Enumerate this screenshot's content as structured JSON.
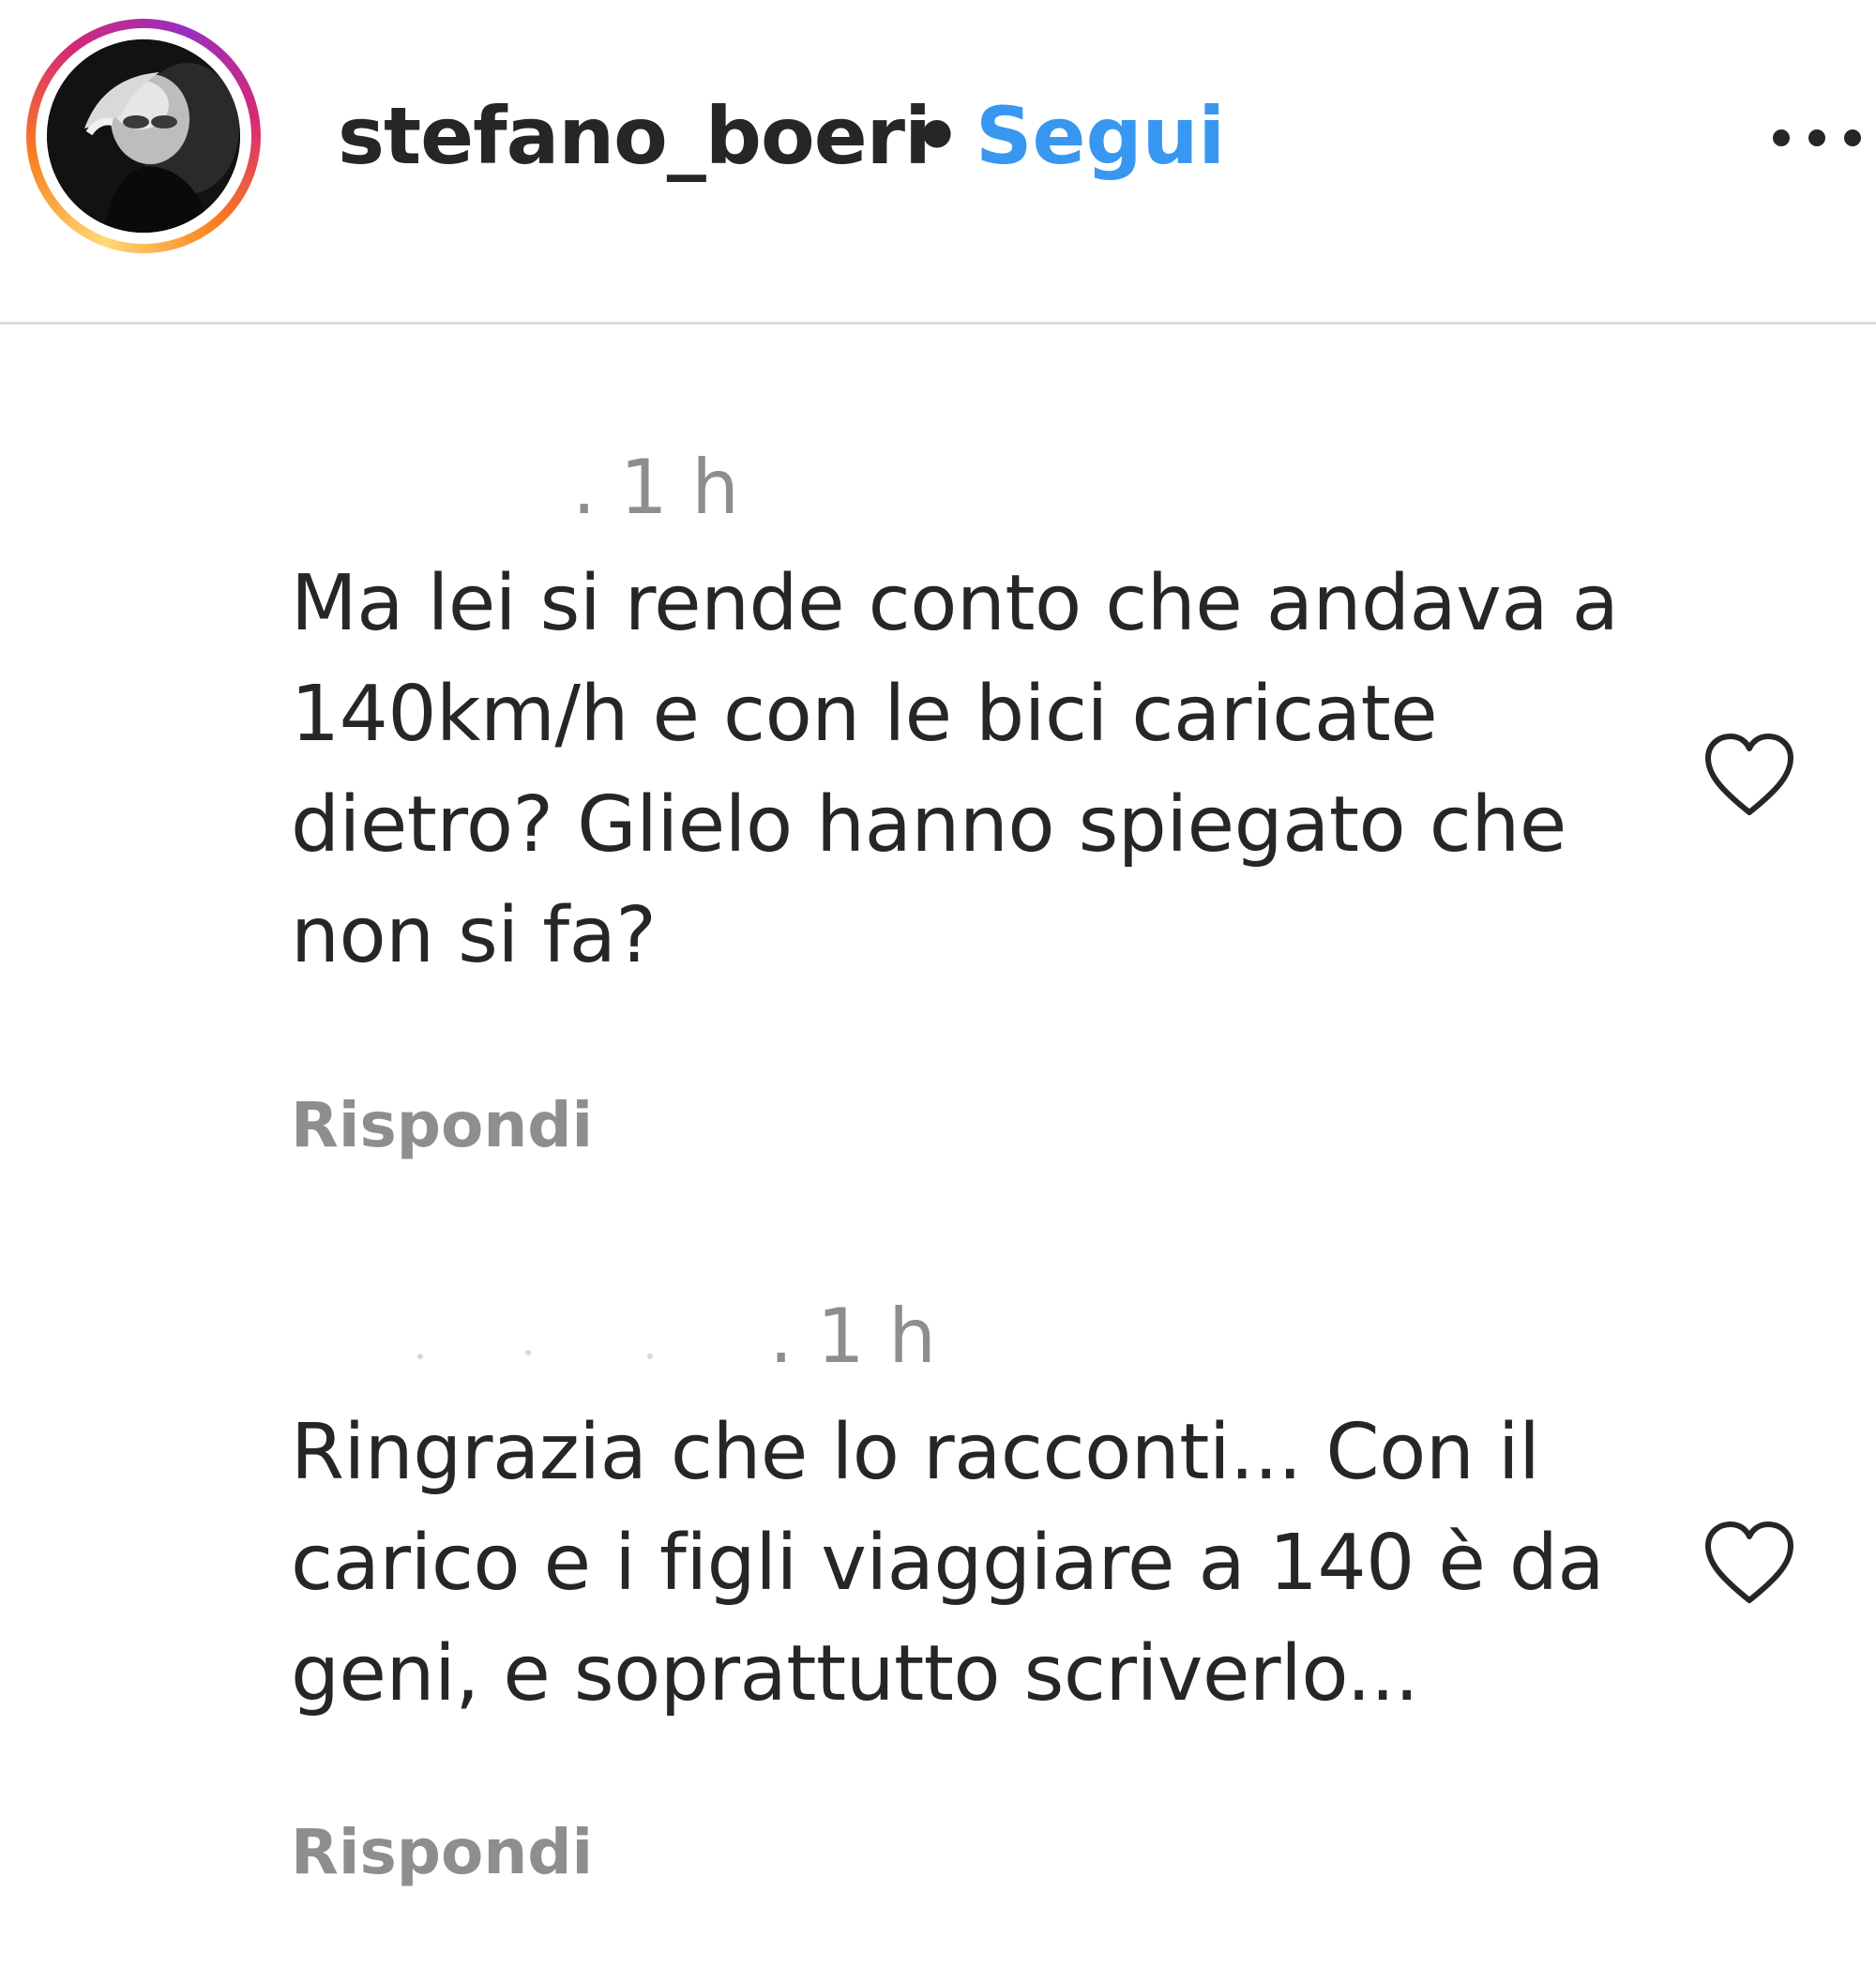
{
  "header": {
    "username": "stefano_boeri",
    "separator": "•",
    "follow_label": "Segui",
    "avatar_icon": "profile-photo",
    "more_icon": "more-options-icon"
  },
  "comments": [
    {
      "time": ". 1 h",
      "text": "Ma lei si rende conto che andava a 140km/h e con le bici caricate dietro? Glielo hanno spiegato che non si fa?",
      "reply_label": "Rispondi",
      "like_icon": "heart-icon"
    },
    {
      "time": ". 1 h",
      "text": "Ringrazia che lo racconti... Con il carico e i figli viaggiare a 140 è da geni, e soprattutto scriverlo...",
      "reply_label": "Rispondi",
      "like_icon": "heart-icon"
    }
  ],
  "colors": {
    "text": "#262626",
    "secondary": "#8e8e8e",
    "link": "#3897f0",
    "divider": "#dbdbdb"
  }
}
